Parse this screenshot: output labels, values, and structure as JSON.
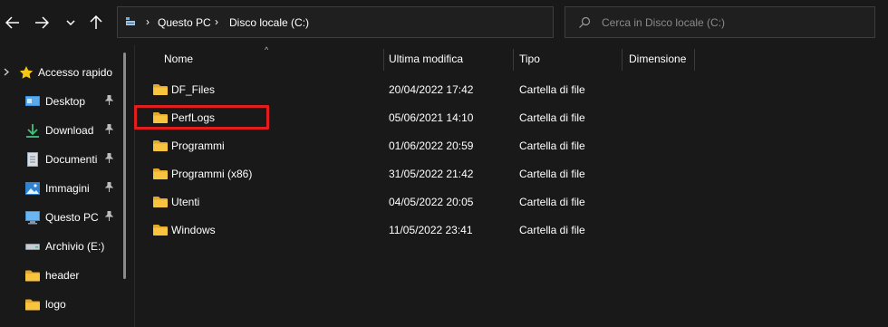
{
  "toolbar": {
    "back_icon": "arrow-left-icon",
    "forward_icon": "arrow-right-icon",
    "recent_icon": "chevron-down-icon",
    "up_icon": "arrow-up-icon"
  },
  "address": {
    "segments": [
      "Questo PC",
      "Disco locale (C:)"
    ],
    "separator": "›",
    "dropdown": "⌵",
    "refresh": "⟳"
  },
  "search": {
    "placeholder": "Cerca in Disco locale (C:)"
  },
  "sidebar": {
    "quick_access": {
      "label": "Accesso rapido",
      "expand": "›"
    },
    "items": [
      {
        "label": "Desktop",
        "icon": "desktop-icon",
        "pinned": true
      },
      {
        "label": "Download",
        "icon": "download-icon",
        "pinned": true
      },
      {
        "label": "Documenti",
        "icon": "documents-icon",
        "pinned": true
      },
      {
        "label": "Immagini",
        "icon": "pictures-icon",
        "pinned": true
      },
      {
        "label": "Questo PC",
        "icon": "this-pc-icon",
        "pinned": true
      },
      {
        "label": "Archivio (E:)",
        "icon": "drive-icon",
        "pinned": false
      },
      {
        "label": "header",
        "icon": "folder-icon",
        "pinned": false
      },
      {
        "label": "logo",
        "icon": "folder-icon",
        "pinned": false
      }
    ],
    "pin_glyph": "📌"
  },
  "columns": {
    "sort_glyph": "^",
    "name": "Nome",
    "modified": "Ultima modifica",
    "type": "Tipo",
    "size": "Dimensione"
  },
  "files": [
    {
      "name": "DF_Files",
      "modified": "20/04/2022 17:42",
      "type": "Cartella di file"
    },
    {
      "name": "PerfLogs",
      "modified": "05/06/2021 14:10",
      "type": "Cartella di file"
    },
    {
      "name": "Programmi",
      "modified": "01/06/2022 20:59",
      "type": "Cartella di file"
    },
    {
      "name": "Programmi (x86)",
      "modified": "31/05/2022 21:42",
      "type": "Cartella di file"
    },
    {
      "name": "Utenti",
      "modified": "04/05/2022 20:05",
      "type": "Cartella di file"
    },
    {
      "name": "Windows",
      "modified": "11/05/2022 23:41",
      "type": "Cartella di file"
    }
  ],
  "colors": {
    "background": "#191919",
    "folder": "#f8c440",
    "highlight": "#e11d1d",
    "star": "#f5c518"
  }
}
